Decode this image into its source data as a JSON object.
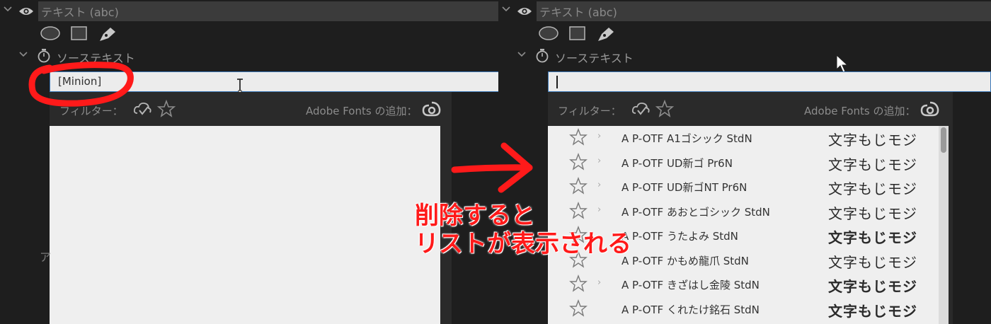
{
  "left": {
    "layer_name": "テキスト (abc)",
    "source_text_label": "ソーステキスト",
    "input_value": "[Minion]",
    "filter_label": "フィルター：",
    "adobe_fonts_label": "Adobe Fonts の追加：",
    "side_label": "ア"
  },
  "right": {
    "layer_name": "テキスト (abc)",
    "source_text_label": "ソーステキスト",
    "input_value": "",
    "filter_label": "フィルター：",
    "adobe_fonts_label": "Adobe Fonts の追加：",
    "font_list": [
      {
        "name": "A P-OTF A1ゴシック StdN",
        "sample": "文字もじモジ",
        "has_chevron": true
      },
      {
        "name": "A P-OTF UD新ゴ Pr6N",
        "sample": "文字もじモジ",
        "has_chevron": true
      },
      {
        "name": "A P-OTF UD新ゴNT Pr6N",
        "sample": "文字もじモジ",
        "has_chevron": true
      },
      {
        "name": "A P-OTF あおとゴシック StdN",
        "sample": "文字もじモジ",
        "has_chevron": true
      },
      {
        "name": "A P-OTF うたよみ StdN",
        "sample": "文字もじモジ",
        "has_chevron": false
      },
      {
        "name": "A P-OTF かもめ龍爪 StdN",
        "sample": "文字もじモジ",
        "has_chevron": false
      },
      {
        "name": "A P-OTF きざはし金陵 StdN",
        "sample": "文字もじモジ",
        "has_chevron": true
      },
      {
        "name": "A P-OTF くれたけ銘石 StdN",
        "sample": "文字もじモジ",
        "has_chevron": false
      }
    ]
  },
  "annotation": {
    "line1": "削除すると",
    "line2": "リストが表示される",
    "color": "#ff1a1a"
  },
  "colors": {
    "accent_border": "#3d79b8",
    "panel_bg": "#1e1e1e",
    "list_bg": "#efefef"
  }
}
